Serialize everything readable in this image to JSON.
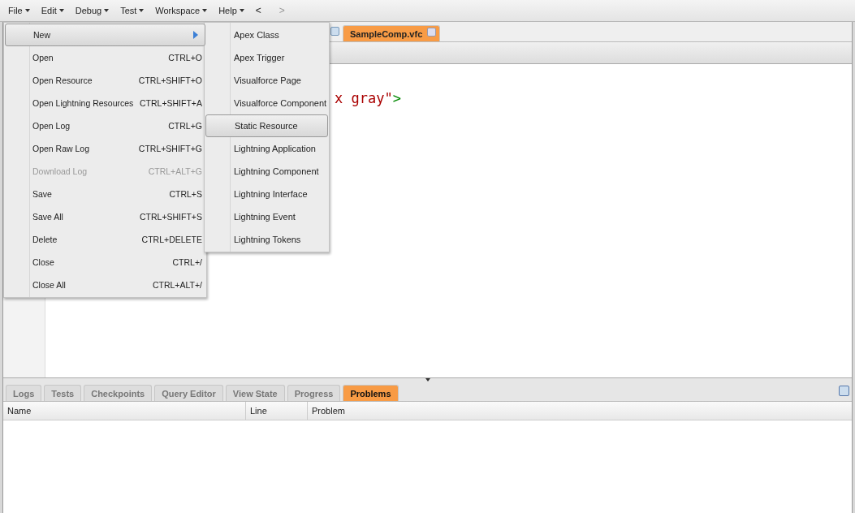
{
  "menubar": [
    {
      "label": "File"
    },
    {
      "label": "Edit"
    },
    {
      "label": "Debug"
    },
    {
      "label": "Test"
    },
    {
      "label": "Workspace"
    },
    {
      "label": "Help"
    }
  ],
  "nav": {
    "back": "<",
    "forward": ">"
  },
  "editor_tabs": [
    {
      "label": "SampleComp.vfc",
      "selected": true
    }
  ],
  "code_tokens": [
    {
      "kind": "string",
      "text": "x gray\""
    },
    {
      "kind": "tag",
      "text": ">"
    }
  ],
  "file_menu": [
    {
      "label": "New",
      "submenu": true,
      "selected": true,
      "disabled": false
    },
    {
      "label": "Open",
      "shortcut": "CTRL+O",
      "submenu": false,
      "selected": false,
      "disabled": false
    },
    {
      "label": "Open Resource",
      "shortcut": "CTRL+SHIFT+O",
      "submenu": false,
      "selected": false,
      "disabled": false
    },
    {
      "label": "Open Lightning Resources",
      "shortcut": "CTRL+SHIFT+A",
      "submenu": false,
      "selected": false,
      "disabled": false
    },
    {
      "label": "Open Log",
      "shortcut": "CTRL+G",
      "submenu": false,
      "selected": false,
      "disabled": false
    },
    {
      "label": "Open Raw Log",
      "shortcut": "CTRL+SHIFT+G",
      "submenu": false,
      "selected": false,
      "disabled": false
    },
    {
      "label": "Download Log",
      "shortcut": "CTRL+ALT+G",
      "submenu": false,
      "selected": false,
      "disabled": true
    },
    {
      "label": "Save",
      "shortcut": "CTRL+S",
      "submenu": false,
      "selected": false,
      "disabled": false
    },
    {
      "label": "Save All",
      "shortcut": "CTRL+SHIFT+S",
      "submenu": false,
      "selected": false,
      "disabled": false
    },
    {
      "label": "Delete",
      "shortcut": "CTRL+DELETE",
      "submenu": false,
      "selected": false,
      "disabled": false
    },
    {
      "label": "Close",
      "shortcut": "CTRL+/",
      "submenu": false,
      "selected": false,
      "disabled": false
    },
    {
      "label": "Close All",
      "shortcut": "CTRL+ALT+/",
      "submenu": false,
      "selected": false,
      "disabled": false
    }
  ],
  "new_submenu": [
    {
      "label": "Apex Class",
      "selected": false
    },
    {
      "label": "Apex Trigger",
      "selected": false
    },
    {
      "label": "Visualforce Page",
      "selected": false
    },
    {
      "label": "Visualforce Component",
      "selected": false
    },
    {
      "label": "Static Resource",
      "selected": true
    },
    {
      "label": "Lightning Application",
      "selected": false
    },
    {
      "label": "Lightning Component",
      "selected": false
    },
    {
      "label": "Lightning Interface",
      "selected": false
    },
    {
      "label": "Lightning Event",
      "selected": false
    },
    {
      "label": "Lightning Tokens",
      "selected": false
    }
  ],
  "panel_tabs": [
    {
      "label": "Logs",
      "selected": false
    },
    {
      "label": "Tests",
      "selected": false
    },
    {
      "label": "Checkpoints",
      "selected": false
    },
    {
      "label": "Query Editor",
      "selected": false
    },
    {
      "label": "View State",
      "selected": false
    },
    {
      "label": "Progress",
      "selected": false
    },
    {
      "label": "Problems",
      "selected": true
    }
  ],
  "table": {
    "columns": [
      "Name",
      "Line",
      "Problem"
    ]
  }
}
